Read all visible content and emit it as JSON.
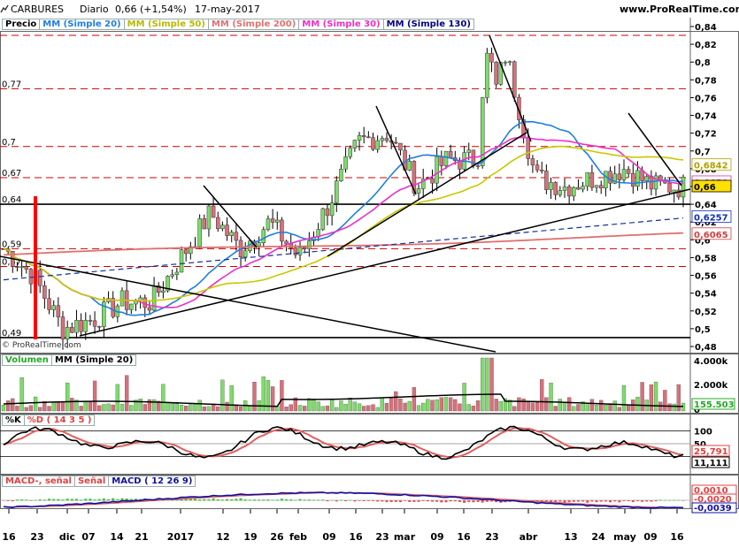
{
  "header": {
    "symbol": "CARBURES",
    "period": "Diario",
    "quote": "0,66 (+1,54%)",
    "date": "17-may-2017",
    "site": "www.ProRealTime.com",
    "logo": "© ProRealTime.com"
  },
  "price_panel": {
    "legend": [
      {
        "label": "Precio",
        "color": "#000000"
      },
      {
        "label": "MM (Simple 20)",
        "color": "#1e7fe0"
      },
      {
        "label": "MM (Simple 50)",
        "color": "#c8c800"
      },
      {
        "label": "MM (Simple 200)",
        "color": "#e07070"
      },
      {
        "label": "MM (Simple 30)",
        "color": "#ee30c8"
      },
      {
        "label": "MM (Simple 130)",
        "color": "#000080"
      }
    ],
    "right_ticks": [
      "0,84",
      "0,82",
      "0,8",
      "0,78",
      "0,76",
      "0,74",
      "0,72",
      "0,7",
      "0,68",
      "0,66",
      "0,64",
      "0,62",
      "0,6",
      "0,58",
      "0,56",
      "0,54",
      "0,52",
      "0,5",
      "0,48"
    ],
    "left_levels": [
      "0,77",
      "0,7",
      "0,67",
      "0,64",
      "0,59",
      "0,57",
      "0,49"
    ],
    "value_tags": [
      {
        "text": "0,6842",
        "color": "#b0a000"
      },
      {
        "text": "0,6650",
        "color": "#e030b0"
      },
      {
        "text": "0,66",
        "color": "#000000"
      },
      {
        "text": "0,6257",
        "color": "#1030c0"
      },
      {
        "text": "0,6065",
        "color": "#d04040"
      }
    ]
  },
  "volume_panel": {
    "legend": [
      {
        "label": "Volumen",
        "color": "#22aa22"
      },
      {
        "label": "MM (Simple 20)",
        "color": "#000000"
      }
    ],
    "right_ticks": [
      "4.000k",
      "2.000k",
      "0"
    ],
    "value_tag": "155.503"
  },
  "stoch_panel": {
    "legend": [
      {
        "label": "%K",
        "color": "#000000"
      },
      {
        "label": "%D ( 14 3 5 )",
        "color": "#e04040"
      }
    ],
    "right_ticks": [
      "100",
      "50",
      "0"
    ],
    "value_tags": [
      "25,791",
      "11,111"
    ]
  },
  "macd_panel": {
    "legend": [
      {
        "label": "MACD-, señal",
        "color": "#e04040"
      },
      {
        "label": "Señal",
        "color": "#e04040"
      },
      {
        "label": "MACD ( 12 26 9)",
        "color": "#1010a0"
      }
    ],
    "value_tags": [
      "0,0010",
      "-0,0020",
      "-0,0039"
    ]
  },
  "x_axis": [
    "16",
    "23",
    "dic",
    "07",
    "14",
    "21",
    "2017",
    "12",
    "19",
    "26",
    "feb",
    "09",
    "16",
    "23",
    "mar",
    "09",
    "16",
    "23",
    "abr",
    "13",
    "24",
    "may",
    "09",
    "16"
  ],
  "chart_data": {
    "type": "candlestick",
    "title": "CARBURES Diario",
    "ylim": [
      0.48,
      0.84
    ],
    "support_lines": [
      0.64,
      0.49
    ],
    "dashed_levels": [
      0.83,
      0.77,
      0.705,
      0.67,
      0.59,
      0.57
    ],
    "approx_close_path": [
      {
        "date": "16",
        "close": 0.59
      },
      {
        "date": "23",
        "close": 0.56
      },
      {
        "date": "dic",
        "close": 0.5
      },
      {
        "date": "07",
        "close": 0.51
      },
      {
        "date": "14",
        "close": 0.53
      },
      {
        "date": "21",
        "close": 0.53
      },
      {
        "date": "2017",
        "close": 0.58
      },
      {
        "date": "12",
        "close": 0.63
      },
      {
        "date": "19",
        "close": 0.59
      },
      {
        "date": "26",
        "close": 0.62
      },
      {
        "date": "feb",
        "close": 0.58
      },
      {
        "date": "09",
        "close": 0.64
      },
      {
        "date": "16",
        "close": 0.71
      },
      {
        "date": "23",
        "close": 0.72
      },
      {
        "date": "mar",
        "close": 0.66
      },
      {
        "date": "09",
        "close": 0.69
      },
      {
        "date": "16",
        "close": 0.69
      },
      {
        "date": "23",
        "close": 0.81
      },
      {
        "date": "abr",
        "close": 0.67
      },
      {
        "date": "13",
        "close": 0.66
      },
      {
        "date": "24",
        "close": 0.67
      },
      {
        "date": "may",
        "close": 0.68
      },
      {
        "date": "09",
        "close": 0.66
      },
      {
        "date": "16",
        "close": 0.66
      }
    ]
  }
}
